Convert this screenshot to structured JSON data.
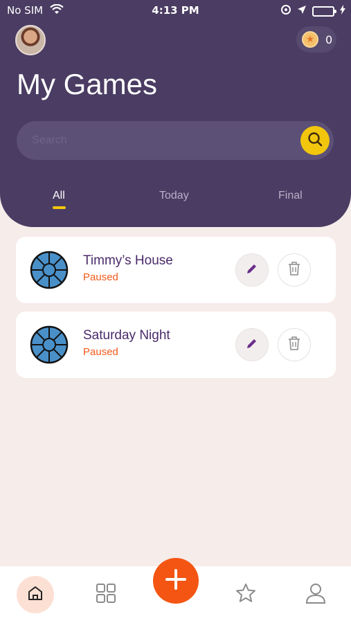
{
  "status_bar": {
    "carrier": "No SIM",
    "time": "4:13 PM"
  },
  "header": {
    "title": "My Games",
    "coins": "0"
  },
  "search": {
    "placeholder": "Search"
  },
  "tabs": [
    {
      "label": "All",
      "active": true
    },
    {
      "label": "Today",
      "active": false
    },
    {
      "label": "Final",
      "active": false
    }
  ],
  "games": [
    {
      "name": "Timmy’s House",
      "status": "Paused"
    },
    {
      "name": "Saturday Night",
      "status": "Paused"
    }
  ],
  "colors": {
    "header": "#4a3c62",
    "accent": "#f2c60c",
    "fab": "#f45513",
    "status": "#f15a1a"
  },
  "bottom_nav": [
    "home-icon",
    "grid-icon",
    "add-icon",
    "star-icon",
    "profile-icon"
  ]
}
